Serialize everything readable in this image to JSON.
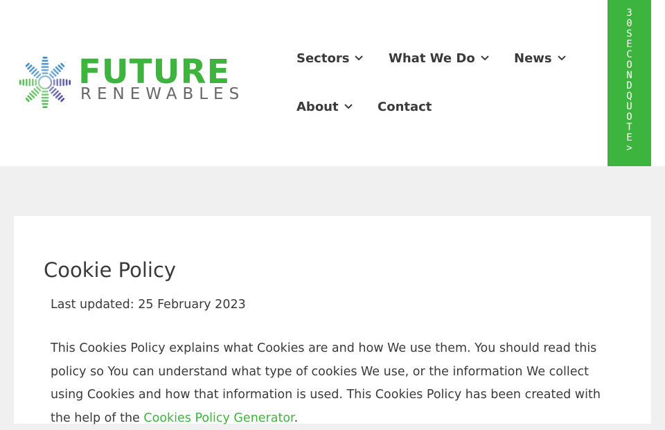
{
  "brand": {
    "name": "FUTURE",
    "tagline": "RENEWABLES",
    "colors": {
      "green": "#3db43d",
      "blue": "#2a7fc1",
      "navy": "#3b3b96",
      "grey_text": "#666666"
    },
    "icon": "starburst-logo-icon"
  },
  "nav": {
    "items": [
      {
        "label": "Sectors",
        "has_dropdown": true
      },
      {
        "label": "What We Do",
        "has_dropdown": true
      },
      {
        "label": "News",
        "has_dropdown": true
      },
      {
        "label": "About",
        "has_dropdown": true
      },
      {
        "label": "Contact",
        "has_dropdown": false
      }
    ],
    "dropdown_icon": "chevron-down-icon"
  },
  "cta": {
    "label": "30SECONDQUOTE>",
    "color": "#3db43d"
  },
  "page": {
    "title": "Cookie Policy",
    "last_updated": "Last updated: 25 February 2023",
    "intro_text": "This Cookies Policy explains what Cookies are and how We use them. You should read this policy so You can understand what type of cookies We use, or the information We collect using Cookies and how that information is used. This Cookies Policy has been created with the help of the ",
    "intro_link": "Cookies Policy Generator",
    "intro_after": "."
  }
}
